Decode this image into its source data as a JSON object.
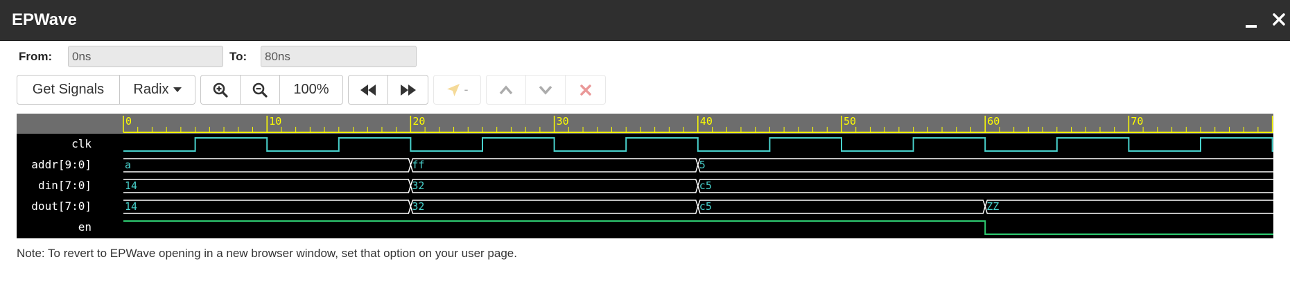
{
  "window": {
    "title": "EPWave"
  },
  "range": {
    "from_label": "From:",
    "from_value": "0ns",
    "to_label": "To:",
    "to_value": "80ns"
  },
  "toolbar": {
    "get_signals": "Get Signals",
    "radix": "Radix",
    "zoom": "100%",
    "cursor_value": "-"
  },
  "waveform": {
    "time_ticks": [
      "0",
      "10",
      "20",
      "30",
      "40",
      "50",
      "60",
      "70"
    ],
    "signals": [
      {
        "name": "clk",
        "type": "clock"
      },
      {
        "name": "addr[9:0]",
        "type": "bus",
        "values": [
          [
            "a",
            0
          ],
          [
            "ff",
            20
          ],
          [
            "5",
            40
          ]
        ]
      },
      {
        "name": "din[7:0]",
        "type": "bus",
        "values": [
          [
            "14",
            0
          ],
          [
            "32",
            20
          ],
          [
            "c5",
            40
          ]
        ]
      },
      {
        "name": "dout[7:0]",
        "type": "bus",
        "values": [
          [
            "14",
            0
          ],
          [
            "32",
            20
          ],
          [
            "c5",
            40
          ],
          [
            "ZZ",
            60
          ]
        ]
      },
      {
        "name": "en",
        "type": "bit",
        "transitions": [
          [
            0,
            1
          ],
          [
            60,
            0
          ]
        ]
      }
    ],
    "colors": {
      "ruler_bg": "#6d6d6d",
      "ruler_fg": "#ffff00",
      "trace": "#48d1cc",
      "bus_value": "#48d1cc",
      "label": "#ffffff"
    }
  },
  "note": "Note: To revert to EPWave opening in a new browser window, set that option on your user page."
}
